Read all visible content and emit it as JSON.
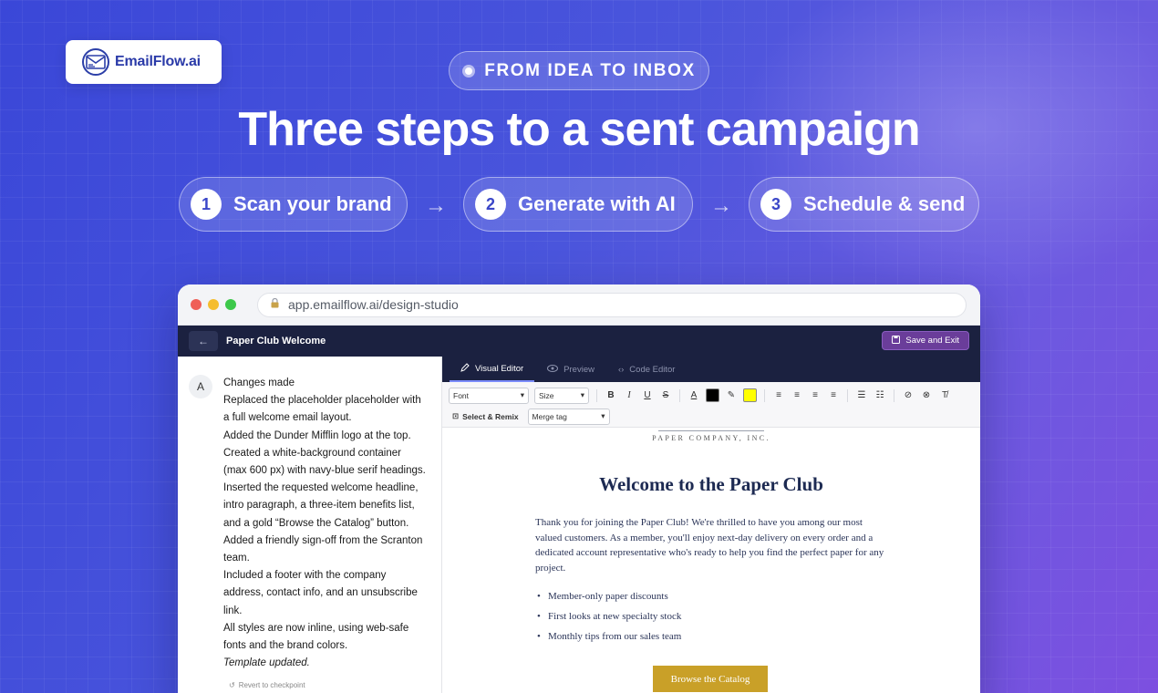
{
  "brand": {
    "name": "EmailFlow.ai"
  },
  "hero": {
    "eyebrow": "FROM IDEA TO INBOX",
    "headline": "Three steps to a sent campaign",
    "steps": [
      {
        "number": "1",
        "label": "Scan your brand"
      },
      {
        "number": "2",
        "label": "Generate with AI"
      },
      {
        "number": "3",
        "label": "Schedule & send"
      }
    ]
  },
  "browser": {
    "url": "app.emailflow.ai/design-studio",
    "traffic_colors": [
      "#ef5f57",
      "#f5bd2e",
      "#3cc84a"
    ]
  },
  "app": {
    "document_title": "Paper Club Welcome",
    "save_label": "Save and Exit",
    "tabs": [
      {
        "label": "Visual Editor",
        "icon": "pencil-icon",
        "active": true
      },
      {
        "label": "Preview",
        "icon": "eye-icon",
        "active": false
      },
      {
        "label": "Code Editor",
        "icon": "code-icon",
        "active": false
      }
    ],
    "toolbar": {
      "font_placeholder": "Font",
      "size_placeholder": "Size",
      "text_color": "#000000",
      "highlight_color": "#ffff00",
      "select_remix_label": "Select & Remix",
      "merge_tag_placeholder": "Merge tag"
    }
  },
  "chat": {
    "avatar_letter": "A",
    "lines": [
      "Changes made",
      "Replaced the placeholder placeholder with",
      "a full welcome email layout.",
      "Added the Dunder Mifflin logo at the top.",
      "Created a white-background container",
      "(max 600 px) with navy-blue serif headings.",
      "Inserted the requested welcome headline,",
      "intro paragraph, a three-item benefits list,",
      "and a gold “Browse the Catalog” button.",
      "Added a friendly sign-off from the Scranton",
      "team.",
      "Included a footer with the company",
      "address, contact info, and an unsubscribe",
      "link.",
      "All styles are now inline, using web-safe",
      "fonts and the brand colors."
    ],
    "final_line": "Template updated.",
    "revert_label": "Revert to checkpoint"
  },
  "email": {
    "company_line": "PAPER COMPANY, INC.",
    "title": "Welcome to the Paper Club",
    "paragraph": "Thank you for joining the Paper Club! We're thrilled to have you among our most valued customers. As a member, you'll enjoy next-day delivery on every order and a dedicated account representative who's ready to help you find the perfect paper for any project.",
    "benefits": [
      "Member-only paper discounts",
      "First looks at new specialty stock",
      "Monthly tips from our sales team"
    ],
    "cta_label": "Browse the Catalog",
    "cta_color": "#c9a028"
  }
}
